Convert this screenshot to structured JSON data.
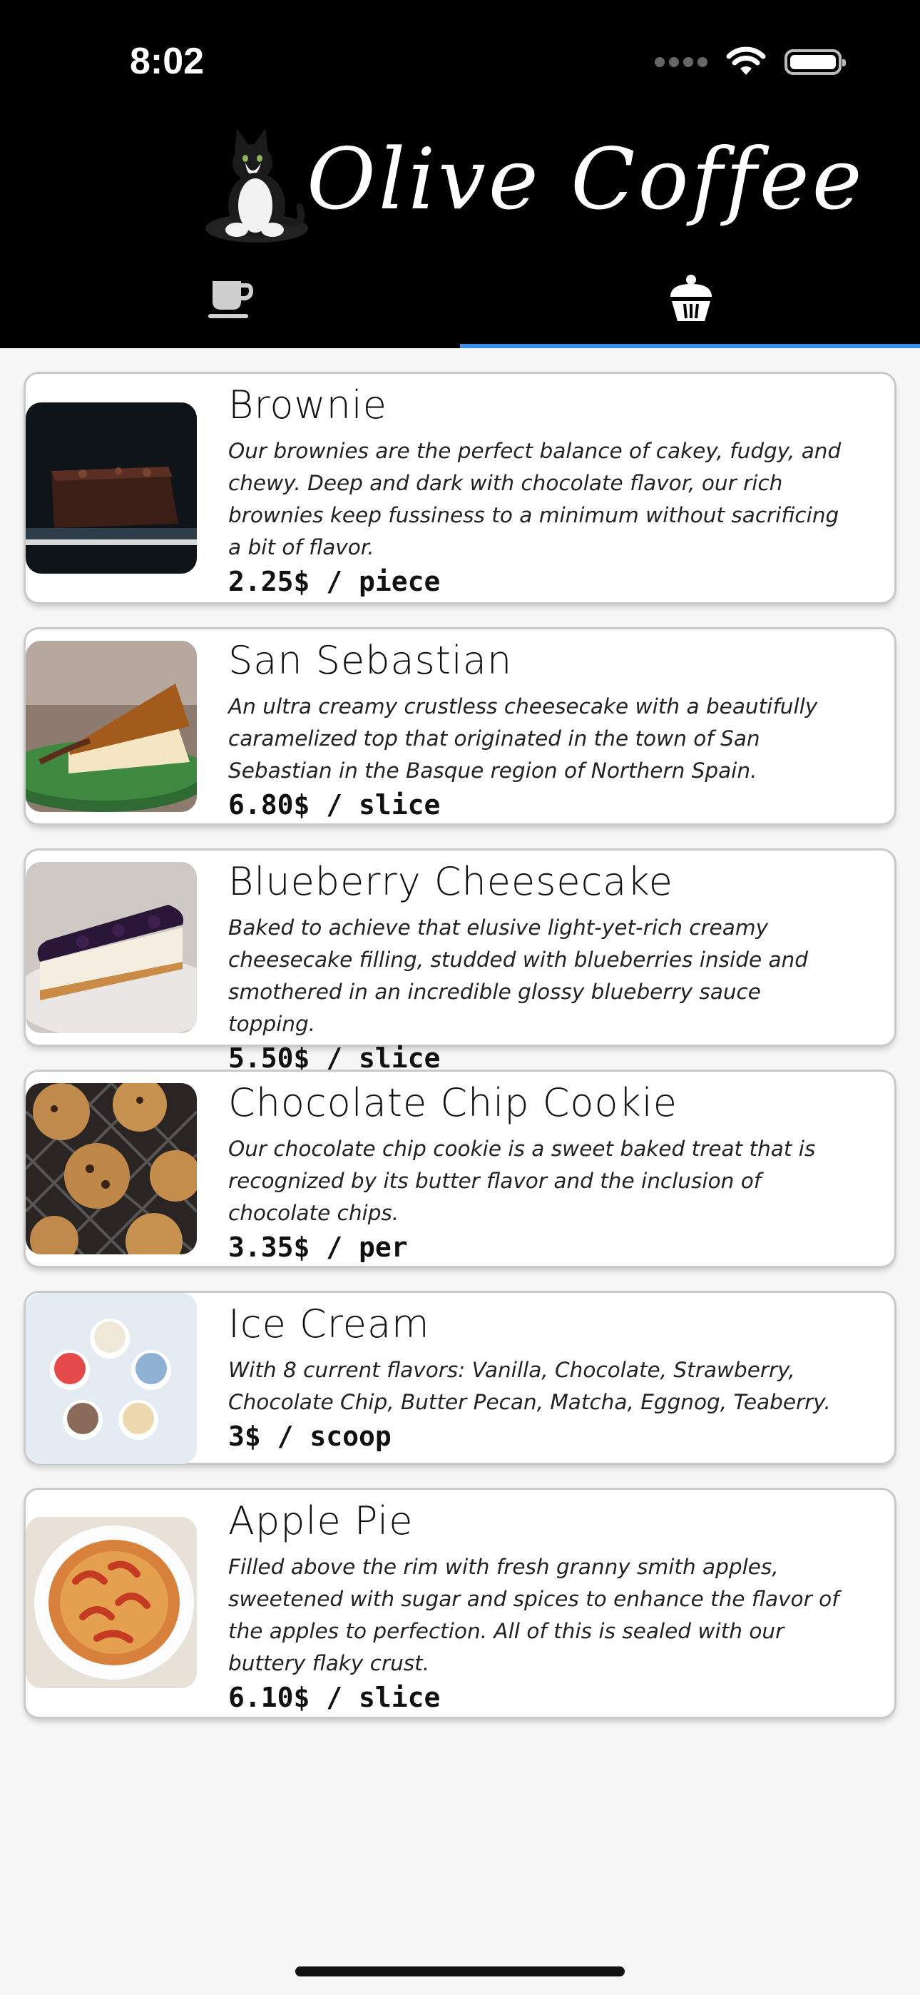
{
  "status_bar": {
    "time": "8:02"
  },
  "brand": {
    "name": "Olive Coffee",
    "logo_icon": "cat-logo-icon"
  },
  "tabs": [
    {
      "id": "drinks",
      "icon": "coffee-cup-icon",
      "selected": false
    },
    {
      "id": "desserts",
      "icon": "cupcake-icon",
      "selected": true
    }
  ],
  "accent_color": "#3a8ee8",
  "menu_items": [
    {
      "title": "Brownie",
      "description": "Our brownies are the perfect balance of cakey, fudgy, and chewy. Deep and dark with chocolate flavor, our rich brownies keep fussiness to a minimum without sacrificing a bit of flavor.",
      "price": "2.25$ / piece"
    },
    {
      "title": "San Sebastian",
      "description": "An ultra creamy crustless cheesecake with a beautifully caramelized top that originated in the town of San Sebastian in the Basque region of Northern Spain.",
      "price": "6.80$ / slice"
    },
    {
      "title": "Blueberry Cheesecake",
      "description": "Baked to achieve that elusive light-yet-rich creamy cheesecake filling, studded with blueberries inside and smothered in an incredible glossy blueberry sauce topping.",
      "price": "5.50$ / slice"
    },
    {
      "title": "Chocolate Chip Cookie",
      "description": "Our chocolate chip cookie is a sweet baked treat that is recognized by its butter flavor and the inclusion of chocolate chips.",
      "price": "3.35$ / per"
    },
    {
      "title": "Ice Cream",
      "description": "With 8 current flavors: Vanilla, Chocolate, Strawberry, Chocolate Chip, Butter Pecan, Matcha, Eggnog, Teaberry.",
      "price": "3$ / scoop"
    },
    {
      "title": "Apple Pie",
      "description": "Filled above the rim with fresh granny smith apples, sweetened with sugar and spices to enhance the flavor of the apples to perfection. All of this is sealed with our buttery flaky crust.",
      "price": "6.10$ / slice"
    }
  ]
}
